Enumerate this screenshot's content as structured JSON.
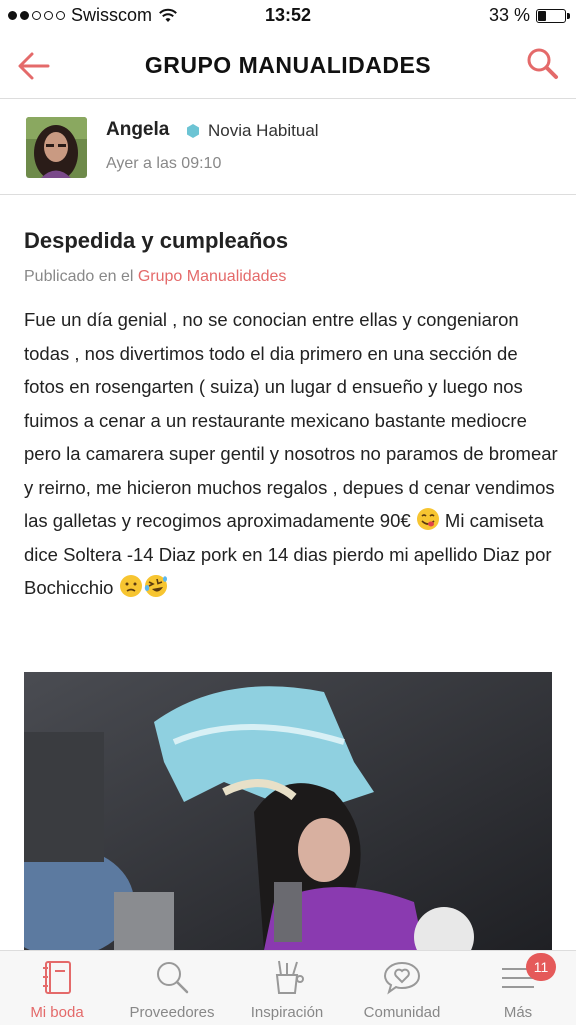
{
  "status_bar": {
    "carrier": "Swisscom",
    "time": "13:52",
    "battery": "33 %",
    "battery_level": 0.33,
    "signal_bars": 2
  },
  "nav": {
    "title": "GRUPO MANUALIDADES",
    "back_icon": "arrow-left-icon",
    "search_icon": "search-icon",
    "accent_color": "#e46a6a"
  },
  "author": {
    "name": "Angela",
    "rank": "Novia Habitual",
    "rank_color": "#6cc4d4",
    "timestamp": "Ayer a las 09:10"
  },
  "post": {
    "title": "Despedida y cumpleaños",
    "published_prefix": "Publicado en el ",
    "group_link": "Grupo Manualidades",
    "body_part1": "Fue un día genial , no se conocian entre ellas y congeniaron todas , nos divertimos todo el dia primero en una sección de fotos en rosengarten ( suiza) un lugar d ensueño y luego nos fuimos a cenar a un restaurante mexicano bastante mediocre pero la camarera super gentil y nosotros no paramos de bromear y reirno, me hicieron muchos regalos , depues d cenar vendimos las galletas y recogimos aproximadamente 90€ ",
    "body_part2": " Mi camiseta dice Soltera -14 Diaz pork en 14 dias pierdo mi apellido Diaz por Bochicchio ",
    "emojis": [
      "face-savoring-food-emoji",
      "worried-face-emoji",
      "rolling-laughing-emoji"
    ]
  },
  "tabbar": {
    "tabs": [
      {
        "label": "Mi boda",
        "icon": "notebook-icon",
        "active": true
      },
      {
        "label": "Proveedores",
        "icon": "search-icon",
        "active": false
      },
      {
        "label": "Inspiración",
        "icon": "craft-supplies-icon",
        "active": false
      },
      {
        "label": "Comunidad",
        "icon": "chat-heart-icon",
        "active": false
      },
      {
        "label": "Más",
        "icon": "menu-icon",
        "active": false,
        "badge": "11"
      }
    ]
  }
}
